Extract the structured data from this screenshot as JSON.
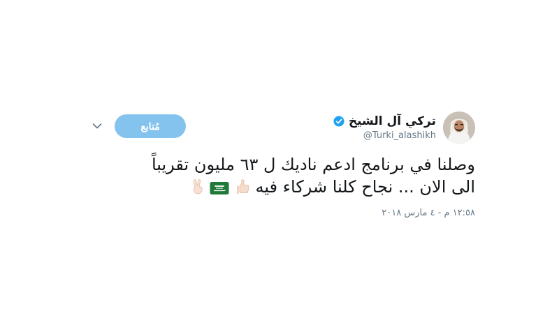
{
  "tweet": {
    "author": {
      "display_name": "تركي آل الشيخ",
      "handle": "@Turki_alashikh",
      "verified": true
    },
    "follow_button_label": "مُتابع",
    "text_line_1": "وصلنا في برنامج ادعم ناديك ل ٦٣ مليون تقريباً",
    "text_line_2": "الى الان ... نجاح كلنا شركاء فيه",
    "emojis": [
      "thumbs-up-icon",
      "saudi-flag-icon",
      "victory-hand-icon"
    ],
    "timestamp": "١٢:٥٨ م - ٤ مارس ٢٠١٨"
  },
  "colors": {
    "follow_button_bg": "#85c3ef",
    "verified_badge": "#1da1f2",
    "text_primary": "#14171a",
    "text_secondary": "#657786",
    "flag_green": "#1f7a3a"
  }
}
